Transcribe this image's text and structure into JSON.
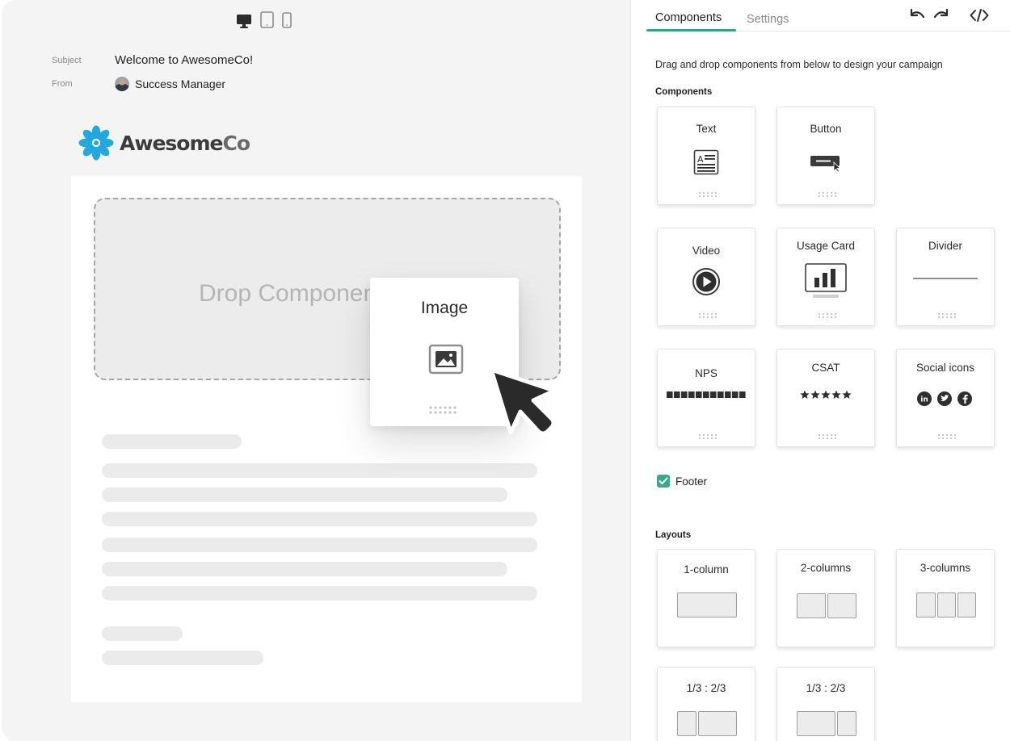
{
  "device_toggle": {
    "items": [
      {
        "name": "desktop",
        "icon": "desktop-icon",
        "active": true
      },
      {
        "name": "tablet",
        "icon": "tablet-icon",
        "active": false
      },
      {
        "name": "mobile",
        "icon": "mobile-icon",
        "active": false
      }
    ]
  },
  "email": {
    "subject_label": "Subject",
    "subject_value": "Welcome to AwesomeCo!",
    "from_label": "From",
    "from_value": "Success Manager",
    "logo_text_main": "Awesome",
    "logo_text_accent": "Co",
    "drop_zone_text": "Drop Component"
  },
  "dragging": {
    "label": "Image",
    "icon": "image-icon"
  },
  "panel": {
    "tabs": [
      {
        "label": "Components",
        "active": true
      },
      {
        "label": "Settings",
        "active": false
      }
    ],
    "toolbar": [
      "undo-icon",
      "redo-icon",
      "code-icon"
    ],
    "hint": "Drag and drop components from below to design your campaign",
    "components_title": "Components",
    "components": [
      {
        "label": "Text",
        "icon": "text-icon"
      },
      {
        "label": "Button",
        "icon": "button-icon"
      },
      {
        "label": "Video",
        "icon": "play-icon"
      },
      {
        "label": "Usage Card",
        "icon": "bar-chart-icon"
      },
      {
        "label": "Divider",
        "icon": "divider-icon"
      },
      {
        "label": "NPS",
        "icon": "nps-scale-icon"
      },
      {
        "label": "CSAT",
        "icon": "star-rating-icon"
      },
      {
        "label": "Social icons",
        "icon": "social-icons"
      }
    ],
    "footer": {
      "label": "Footer",
      "checked": true
    },
    "layouts_title": "Layouts",
    "layouts": [
      {
        "label": "1-column"
      },
      {
        "label": "2-columns"
      },
      {
        "label": "3-columns"
      },
      {
        "label": "1/3 : 2/3"
      },
      {
        "label": "1/3 : 2/3"
      }
    ]
  },
  "colors": {
    "accent": "#2fa38c",
    "checkbox": "#3aa78f",
    "logo_flower": "#22a8e0"
  }
}
